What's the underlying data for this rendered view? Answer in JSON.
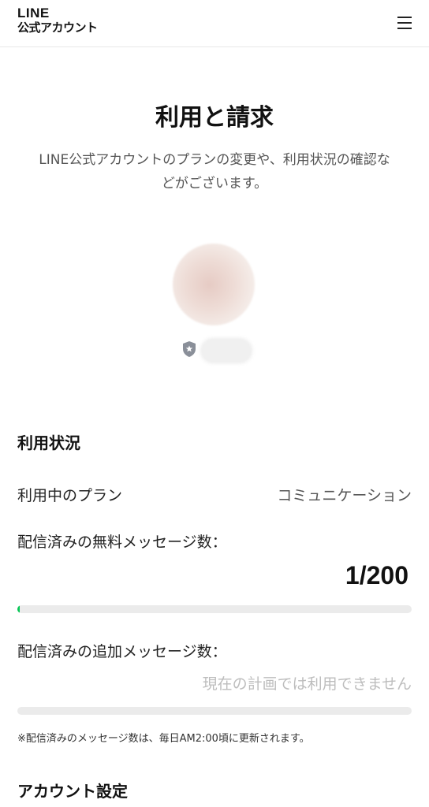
{
  "header": {
    "logo_line1": "LINE",
    "logo_line2": "公式アカウント",
    "menu_icon": "hamburger-menu-icon"
  },
  "page": {
    "title": "利用と請求",
    "description": "LINE公式アカウントのプランの変更や、利用状況の確認などがございます。"
  },
  "profile": {
    "badge_icon": "shield-star-icon",
    "badge_color": "#8a8f99"
  },
  "usage": {
    "section_title": "利用状況",
    "plan_label": "利用中のプラン",
    "plan_value": "コミュニケーション",
    "free_label": "配信済みの無料メッセージ数：",
    "free_count": "1/200",
    "free_progress": 0.005,
    "additional_label": "配信済みの追加メッセージ数：",
    "additional_value": "現在の計画では利用できません",
    "additional_progress": 0,
    "note": "※配信済みのメッセージ数は、毎日AM2:00頃に更新されます。"
  },
  "account": {
    "section_title": "アカウント設定"
  },
  "colors": {
    "accent": "#06c755",
    "bar_track": "#ebebeb",
    "muted_text": "#bdbdbd"
  }
}
